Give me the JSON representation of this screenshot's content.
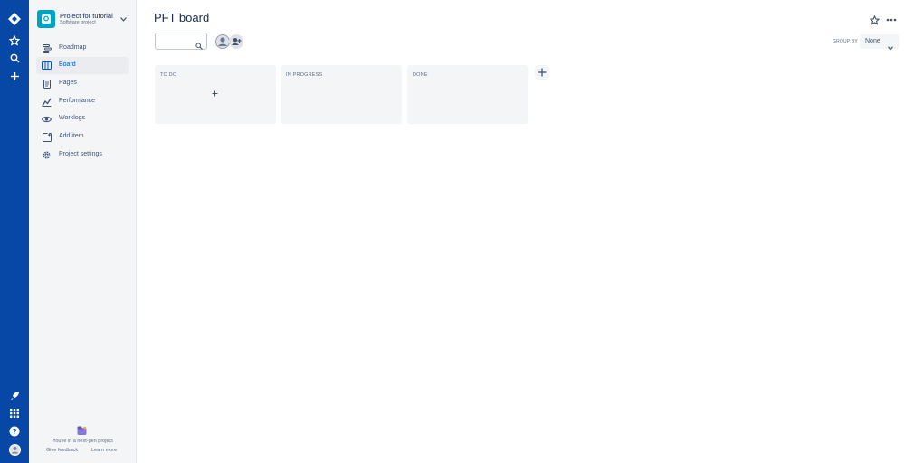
{
  "global_nav": {
    "icons": [
      "jira-logo-icon",
      "star-icon",
      "search-icon",
      "create-plus-icon",
      "rocket-icon",
      "app-switcher-icon",
      "help-icon",
      "profile-avatar-icon"
    ]
  },
  "project": {
    "name": "Project for tutorial",
    "type": "Software project"
  },
  "sidebar": {
    "items": [
      {
        "label": "Roadmap",
        "icon": "roadmap-icon"
      },
      {
        "label": "Board",
        "icon": "board-icon",
        "active": true
      },
      {
        "label": "Pages",
        "icon": "pages-icon"
      },
      {
        "label": "Performance",
        "icon": "performance-icon"
      },
      {
        "label": "Worklogs",
        "icon": "worklogs-icon"
      },
      {
        "label": "Add item",
        "icon": "add-item-icon"
      },
      {
        "label": "Project settings",
        "icon": "settings-gear-icon"
      }
    ],
    "footer": {
      "text": "You're in a next-gen project",
      "feedback_label": "Give feedback",
      "learn_more_label": "Learn more"
    }
  },
  "board": {
    "title": "PFT board",
    "search_placeholder": "",
    "group_by_label": "GROUP BY",
    "group_by_value": "None",
    "columns": [
      {
        "title": "TO DO"
      },
      {
        "title": "IN PROGRESS"
      },
      {
        "title": "DONE"
      }
    ]
  },
  "colors": {
    "global_nav_bg": "#0747a6",
    "sidebar_bg": "#f4f5f7",
    "active_item_bg": "#ebecf0",
    "column_bg": "#f4f5f7",
    "project_avatar_bg": "#00a3bf"
  }
}
